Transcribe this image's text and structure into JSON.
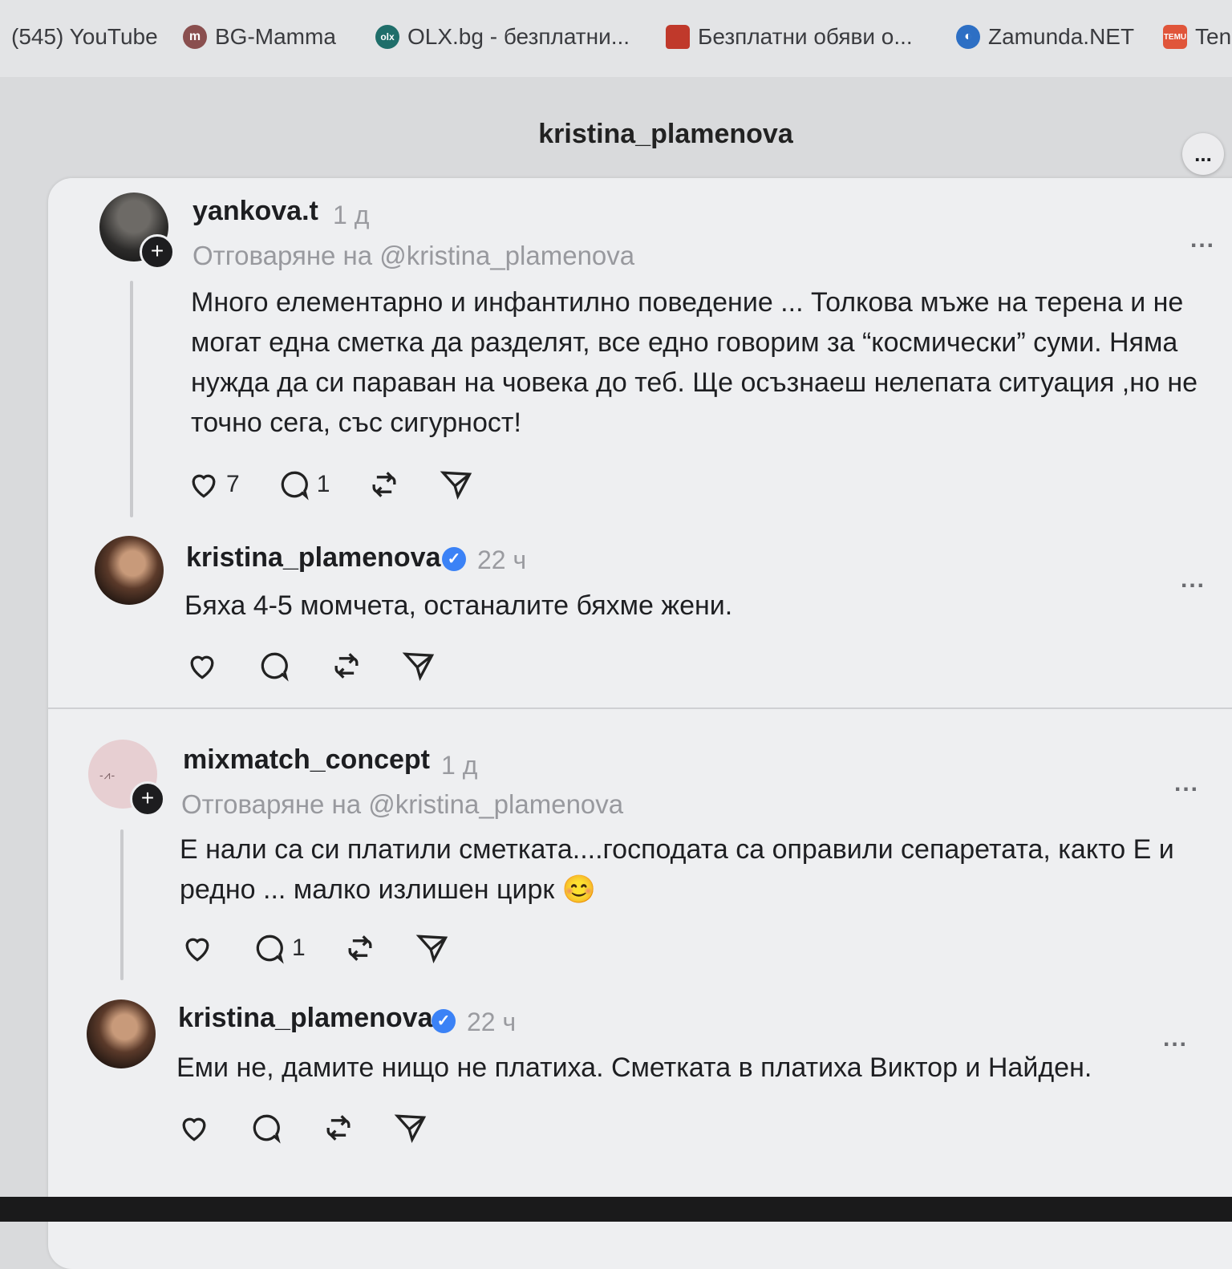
{
  "bookmarks": [
    {
      "label": "(545) YouTube",
      "icon": "youtube-icon"
    },
    {
      "label": "BG-Mamma",
      "icon": "bgmamma-icon"
    },
    {
      "label": "OLX.bg - безплатни...",
      "icon": "olx-icon"
    },
    {
      "label": "Безплатни обяви о...",
      "icon": "bag-icon"
    },
    {
      "label": "Zamunda.NET",
      "icon": "zamunda-icon"
    },
    {
      "label": "Ten",
      "icon": "temu-icon"
    }
  ],
  "page": {
    "title": "kristina_plamenova",
    "menu_label": "..."
  },
  "posts": [
    {
      "username": "yankova.t",
      "time": "1 д",
      "reply_to": "Отговаряне на @kristina_plamenova",
      "text": "Много елементарно и инфантилно поведение ... Толкова мъже на терена и не могат една сметка да разделят, все едно говорим за “космически” суми. Няма нужда да си параван на човека до теб. Ще осъзнаеш нелепата ситуация ,но не точно сега, със сигурност!",
      "likes": "7",
      "replies": "1",
      "more": "..."
    },
    {
      "username": "kristina_plamenova",
      "verified": true,
      "time": "22 ч",
      "text": "Бяха 4-5 момчета, останалите бяхме жени.",
      "more": "..."
    },
    {
      "username": "mixmatch_concept",
      "time": "1 д",
      "reply_to": "Отговаряне на @kristina_plamenova",
      "text": "Е нали са си платили сметката....господата са оправили сепаретата, както Е и редно ... малко излишен цирк 😊",
      "replies": "1",
      "more": "..."
    },
    {
      "username": "kristina_plamenova",
      "verified": true,
      "time": "22 ч",
      "text": "Еми не, дамите нищо не платиха. Сметката в платиха Виктор и Найден.",
      "more": "..."
    }
  ],
  "colors": {
    "verified": "#3b82f6",
    "background": "#eeeff1"
  }
}
